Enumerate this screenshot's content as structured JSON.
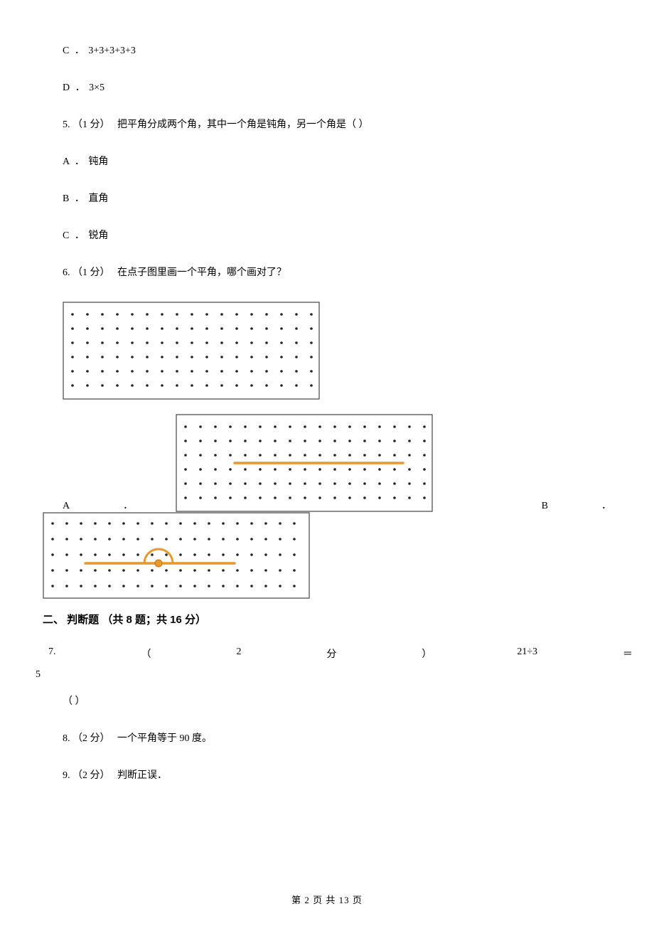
{
  "options_prev": {
    "c": {
      "letter": "C ．",
      "text": "3+3+3+3+3"
    },
    "d": {
      "letter": "D ．",
      "text": "3×5"
    }
  },
  "q5": {
    "num": "5.",
    "points": "（1 分）",
    "stem": "把平角分成两个角，其中一个角是钝角，另一个角是（    ）",
    "a": {
      "letter": "A ．",
      "text": "钝角"
    },
    "b": {
      "letter": "B ．",
      "text": "直角"
    },
    "c": {
      "letter": "C ．",
      "text": "锐角"
    }
  },
  "q6": {
    "num": "6.",
    "points": "（1 分）",
    "stem": "在点子图里画一个平角，哪个画对了？",
    "opt_a": "A",
    "dot_a": "．",
    "opt_b": "B",
    "dot_b": "．"
  },
  "section2": "二、 判断题 （共 8 题；共 16 分）",
  "q7": {
    "num": "7.",
    "lparen": "（",
    "pts_num": "2",
    "pts_unit": "分",
    "rparen": "）",
    "expr": "21÷3",
    "eq": "＝",
    "ans": "5",
    "blank": "（    ）"
  },
  "q8": {
    "num": "8.",
    "points": "（2 分）",
    "stem": "一个平角等于 90 度。"
  },
  "q9": {
    "num": "9.",
    "points": "（2 分）",
    "stem": "判断正误．"
  },
  "footer": "第 2 页 共 13 页"
}
